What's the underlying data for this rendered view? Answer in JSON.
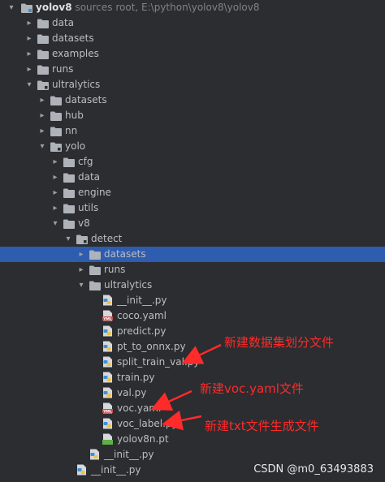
{
  "project": {
    "name": "yolov8",
    "sub": "sources root,  E:\\python\\yolov8\\yolov8"
  },
  "tree": [
    {
      "name": "folder-data",
      "label": "data"
    },
    {
      "name": "folder-datasets",
      "label": "datasets"
    },
    {
      "name": "folder-examples",
      "label": "examples"
    },
    {
      "name": "folder-runs",
      "label": "runs"
    },
    {
      "name": "folder-ultralytics",
      "label": "ultralytics"
    },
    {
      "name": "folder-ultralytics-datasets",
      "label": "datasets"
    },
    {
      "name": "folder-hub",
      "label": "hub"
    },
    {
      "name": "folder-nn",
      "label": "nn"
    },
    {
      "name": "folder-yolo",
      "label": "yolo"
    },
    {
      "name": "folder-cfg",
      "label": "cfg"
    },
    {
      "name": "folder-yolo-data",
      "label": "data"
    },
    {
      "name": "folder-engine",
      "label": "engine"
    },
    {
      "name": "folder-utils",
      "label": "utils"
    },
    {
      "name": "folder-v8",
      "label": "v8"
    },
    {
      "name": "folder-detect",
      "label": "detect"
    },
    {
      "name": "folder-detect-datasets",
      "label": "datasets"
    },
    {
      "name": "folder-detect-runs",
      "label": "runs"
    },
    {
      "name": "folder-detect-ultralytics",
      "label": "ultralytics"
    },
    {
      "name": "file-init-detect",
      "label": "__init__.py"
    },
    {
      "name": "file-coco-yaml",
      "label": "coco.yaml"
    },
    {
      "name": "file-predict",
      "label": "predict.py"
    },
    {
      "name": "file-pt-to-onnx",
      "label": "pt_to_onnx.py"
    },
    {
      "name": "file-split-train-val",
      "label": "split_train_val.py"
    },
    {
      "name": "file-train",
      "label": "train.py"
    },
    {
      "name": "file-val",
      "label": "val.py"
    },
    {
      "name": "file-voc-yaml",
      "label": "voc.yaml"
    },
    {
      "name": "file-voc-label",
      "label": "voc_label.py"
    },
    {
      "name": "file-yolov8n-pt",
      "label": "yolov8n.pt"
    },
    {
      "name": "file-init-v8",
      "label": "__init__.py"
    },
    {
      "name": "file-init-yolo",
      "label": "__init__.py"
    }
  ],
  "annotations": {
    "a1": "新建数据集划分文件",
    "a2": "新建voc.yaml文件",
    "a3": "新建txt文件生成文件"
  },
  "watermark": "CSDN @m0_63493883",
  "icon_labels": {
    "yaml": "YML"
  },
  "colors": {
    "background": "#2b2d30",
    "selection": "#2e5caf",
    "folder": "#aeb3b9",
    "annotation": "#ff2a2a",
    "python_blue": "#3f8fd6",
    "python_yellow": "#f0c33c",
    "yaml_red": "#cf4a4a",
    "pt_green": "#5fb04a"
  }
}
